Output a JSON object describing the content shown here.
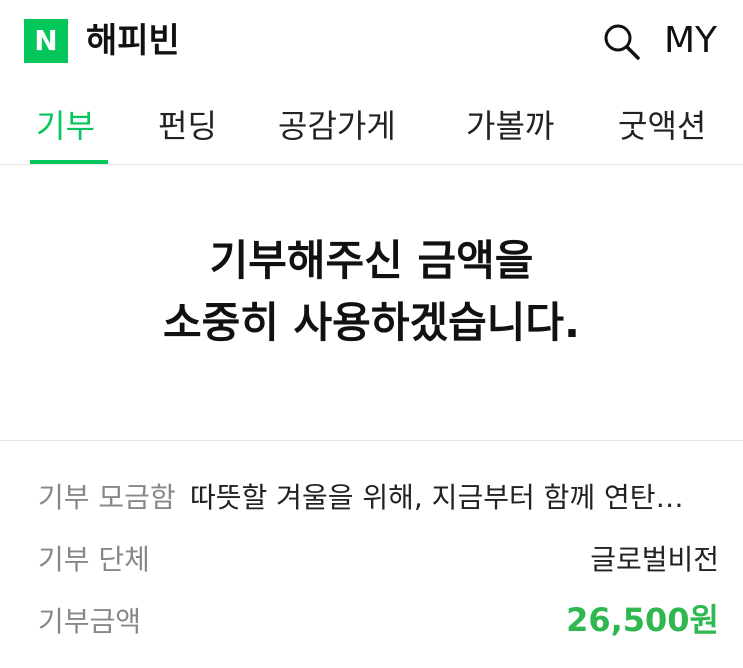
{
  "header": {
    "logo_letter": "N",
    "service_name": "해피빈",
    "my_label": "MY",
    "brand_color": "#03c75a"
  },
  "tabs": [
    {
      "label": "기부",
      "active": true
    },
    {
      "label": "펀딩",
      "active": false
    },
    {
      "label": "공감가게",
      "active": false
    },
    {
      "label": "가볼까",
      "active": false
    },
    {
      "label": "굿액션",
      "active": false
    }
  ],
  "message": {
    "line1": "기부해주신 금액을",
    "line2": "소중히 사용하겠습니다."
  },
  "details": {
    "campaign_label": "기부 모금함",
    "campaign_value": "따뜻할 겨울을 위해, 지금부터 함께 연탄을 …",
    "org_label": "기부 단체",
    "org_value": "글로벌비전",
    "amount_label": "기부금액",
    "amount_value": "26,500원",
    "amount_color": "#2fb84f"
  }
}
